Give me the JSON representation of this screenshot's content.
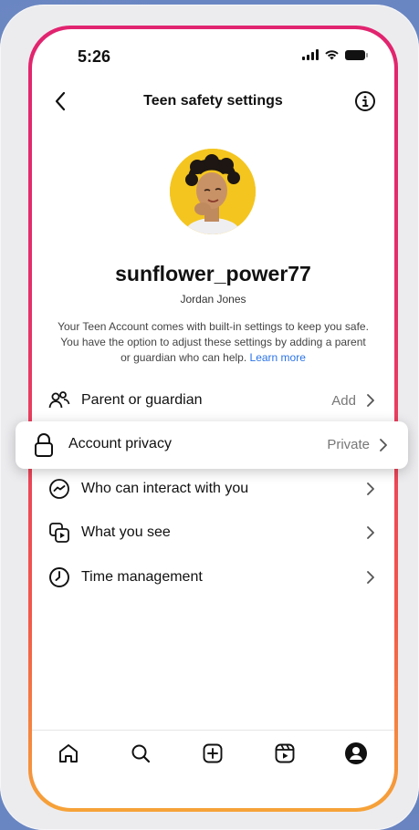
{
  "status_bar": {
    "time": "5:26"
  },
  "header": {
    "title": "Teen safety settings",
    "back_icon": "chevron-left-icon",
    "info_icon": "info-icon"
  },
  "profile": {
    "username": "sunflower_power77",
    "full_name": "Jordan Jones",
    "description": "Your Teen Account comes with built-in settings to keep you safe. You have the option to adjust these settings by adding a parent or guardian who can help.",
    "learn_more": "Learn more"
  },
  "settings": {
    "parent_guardian": {
      "label": "Parent or guardian",
      "value": "Add",
      "icon": "people-icon"
    },
    "account_privacy": {
      "label": "Account privacy",
      "value": "Private",
      "icon": "lock-icon"
    },
    "interactions": {
      "label": "Who can interact with you",
      "value": "",
      "icon": "messenger-icon"
    },
    "what_you_see": {
      "label": "What you see",
      "value": "",
      "icon": "media-icon"
    },
    "time_management": {
      "label": "Time management",
      "value": "",
      "icon": "clock-icon"
    }
  },
  "nav": {
    "items": [
      "home-icon",
      "search-icon",
      "create-icon",
      "reels-icon",
      "profile-icon"
    ]
  },
  "colors": {
    "accent_link": "#2a73e8",
    "frame_gradient_top": "#e1246f",
    "frame_gradient_bottom": "#f6a338",
    "background": "#6a86c2"
  }
}
